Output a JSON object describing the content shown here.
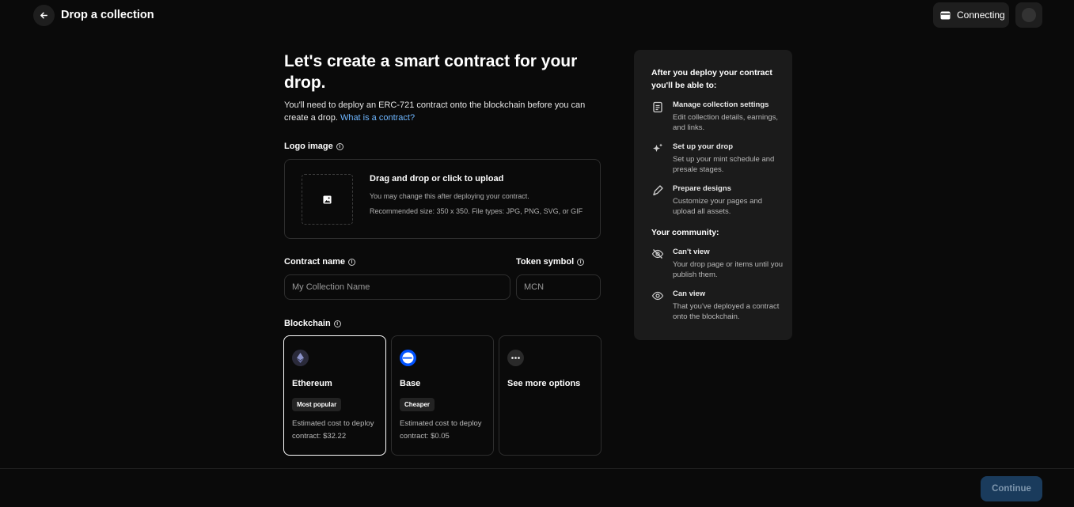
{
  "header": {
    "title": "Drop a collection",
    "connect_label": "Connecting"
  },
  "intro": {
    "heading": "Let's create a smart contract for your drop.",
    "subtext": "You'll need to deploy an ERC-721 contract onto the blockchain before you can create a drop.",
    "link": "What is a contract?"
  },
  "logo": {
    "label": "Logo image",
    "upload_title": "Drag and drop or click to upload",
    "note1": "You may change this after deploying your contract.",
    "note2": "Recommended size: 350 x 350. File types: JPG, PNG, SVG, or GIF"
  },
  "contract_name": {
    "label": "Contract name",
    "placeholder": "My Collection Name"
  },
  "token_symbol": {
    "label": "Token symbol",
    "placeholder": "MCN"
  },
  "blockchain": {
    "label": "Blockchain",
    "options": [
      {
        "name": "Ethereum",
        "badge": "Most popular",
        "cost": "Estimated cost to deploy contract: $32.22",
        "selected": true
      },
      {
        "name": "Base",
        "badge": "Cheaper",
        "cost": "Estimated cost to deploy contract: $0.05",
        "selected": false
      },
      {
        "name": "See more options"
      }
    ]
  },
  "side": {
    "title": "After you deploy your contract you'll be able to:",
    "items": [
      {
        "icon": "clipboard-icon",
        "title": "Manage collection settings",
        "desc": "Edit collection details, earnings, and links."
      },
      {
        "icon": "sparkle-icon",
        "title": "Set up your drop",
        "desc": "Set up your mint schedule and presale stages."
      },
      {
        "icon": "pen-tool-icon",
        "title": "Prepare designs",
        "desc": "Customize your pages and upload all assets."
      }
    ],
    "community_title": "Your community:",
    "community": [
      {
        "icon": "eye-off-icon",
        "title": "Can't view",
        "desc": "Your drop page or items until you publish them."
      },
      {
        "icon": "eye-icon",
        "title": "Can view",
        "desc": "That you've deployed a contract onto the blockchain."
      }
    ]
  },
  "footer": {
    "continue_label": "Continue"
  }
}
